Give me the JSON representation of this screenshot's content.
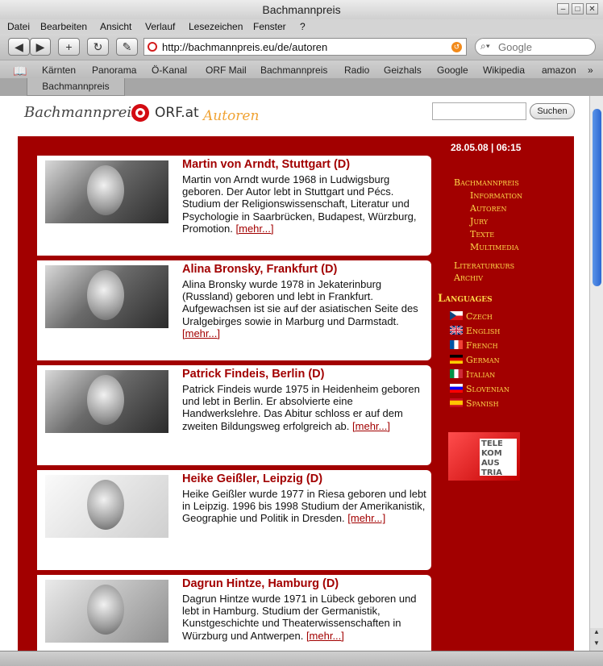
{
  "window": {
    "title": "Bachmannpreis"
  },
  "menu": [
    "Datei",
    "Bearbeiten",
    "Ansicht",
    "Verlauf",
    "Lesezeichen",
    "Fenster",
    "?"
  ],
  "toolbar": {
    "back": "◀",
    "forward": "▶",
    "add": "+",
    "reload": "↻",
    "edit": "✎",
    "url": "http://bachmannpreis.eu/de/autoren",
    "search_placeholder": "Google"
  },
  "bookmarks": [
    "Kärnten",
    "Panorama",
    "Ö-Kanal",
    "ORF Mail",
    "Bachmannpreis",
    "Radio",
    "Geizhals",
    "Google",
    "Wikipedia",
    "amazon"
  ],
  "tab": {
    "label": "Bachmannpreis"
  },
  "page": {
    "logo_text": "Bachmannpreis",
    "orf_text": "ORF.at",
    "section": "Autoren",
    "search_button": "Suchen",
    "datetime": "28.05.08 | 06:15",
    "more_label": "[mehr...]",
    "authors": [
      {
        "name": "Martin von Arndt, Stuttgart (D)",
        "text": "Martin von Arndt wurde 1968 in Ludwigsburg geboren. Der Autor lebt in Stuttgart und Pécs. Studium der Religionswissenschaft, Literatur und Psychologie in Saarbrücken, Budapest, Würzburg, Promotion."
      },
      {
        "name": "Alina Bronsky, Frankfurt (D)",
        "text": "Alina Bronsky wurde 1978 in Jekaterinburg (Russland) geboren und lebt in Frankfurt. Aufgewachsen ist sie auf der asiatischen Seite des Uralgebirges sowie in Marburg und Darmstadt."
      },
      {
        "name": "Patrick Findeis, Berlin (D)",
        "text": "Patrick Findeis wurde 1975 in Heidenheim geboren und lebt in Berlin. Er absolvierte eine Handwerkslehre. Das Abitur schloss er auf dem zweiten Bildungsweg erfolgreich ab."
      },
      {
        "name": "Heike Geißler, Leipzig (D)",
        "text": "Heike Geißler wurde 1977 in Riesa geboren und lebt in Leipzig. 1996 bis 1998 Studium der Amerikanistik, Geographie und Politik in Dresden."
      },
      {
        "name": "Dagrun Hintze, Hamburg (D)",
        "text": "Dagrun Hintze wurde 1971 in Lübeck geboren und lebt in Hamburg. Studium der Germanistik, Kunstgeschichte und Theaterwissenschaften in Würzburg und Antwerpen."
      }
    ],
    "nav": {
      "main": "Bachmannpreis",
      "sub": [
        "Information",
        "Autoren",
        "Jury",
        "Texte",
        "Multimedia"
      ],
      "literaturkurs": "Literaturkurs",
      "archiv": "Archiv",
      "languages_title": "Languages",
      "languages": [
        "Czech",
        "English",
        "French",
        "German",
        "Italian",
        "Slovenian",
        "Spanish"
      ]
    },
    "sponsor_text": "TELE KOM AUS TRIA"
  },
  "colors": {
    "brand_red": "#a20000",
    "nav_yellow": "#ffd94a",
    "orange": "#f0a334"
  }
}
